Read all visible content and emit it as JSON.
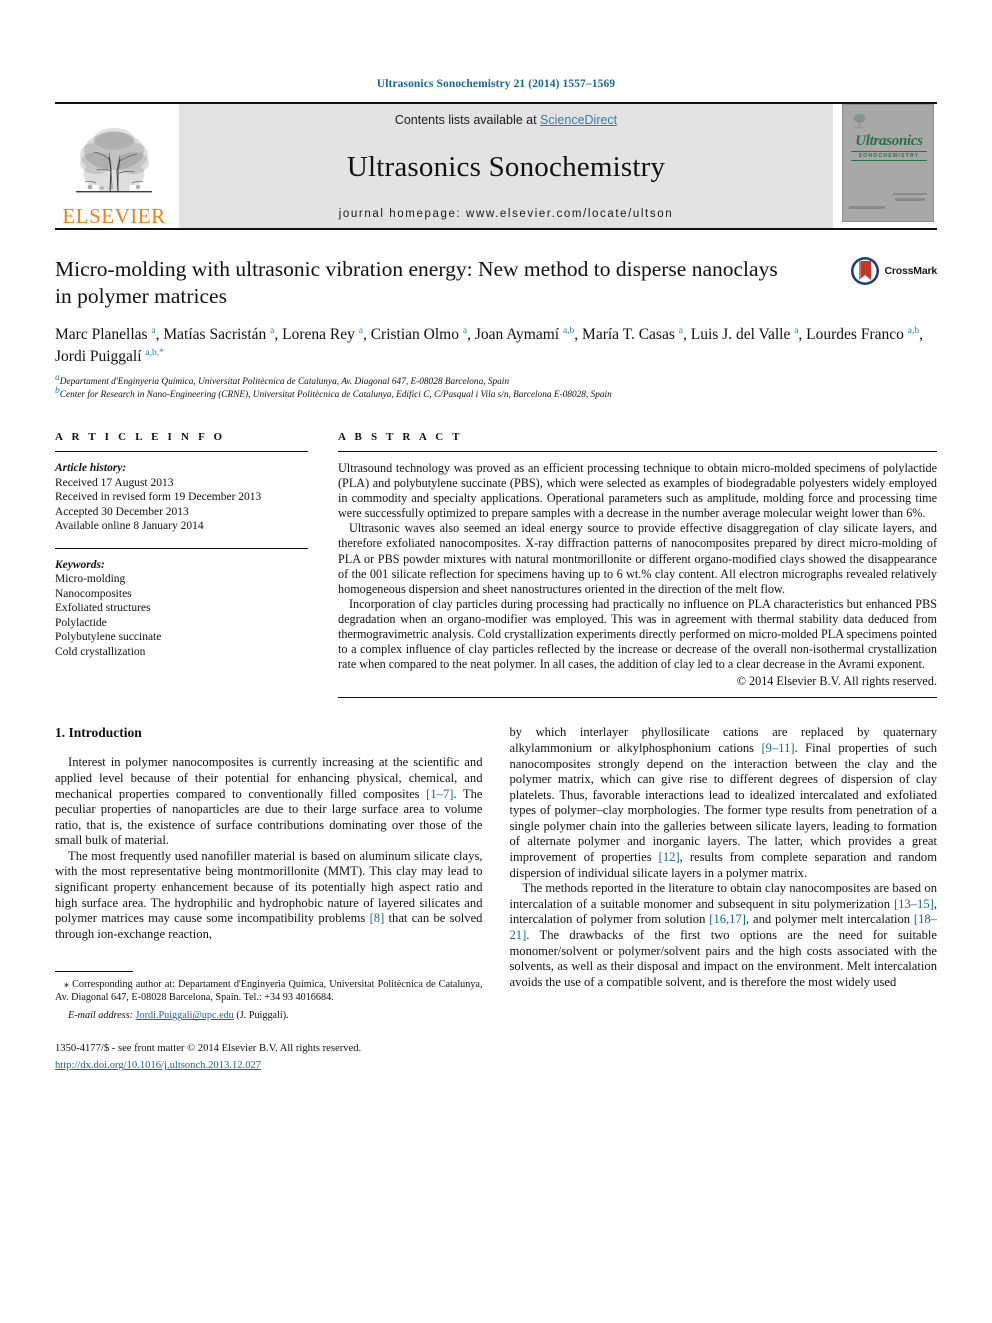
{
  "running_head": "Ultrasonics Sonochemistry 21 (2014) 1557–1569",
  "masthead": {
    "publisher": "ELSEVIER",
    "contents_prefix": "Contents lists available at ",
    "contents_link": "ScienceDirect",
    "journal_name": "Ultrasonics Sonochemistry",
    "homepage": "journal homepage: www.elsevier.com/locate/ultson",
    "cover": {
      "title": "Ultrasonics",
      "subtitle": "SONOCHEMISTRY"
    }
  },
  "article": {
    "title": "Micro-molding with ultrasonic vibration energy: New method to disperse nanoclays in polymer matrices",
    "crossmark_label": "CrossMark",
    "authors_html": "Marc Planellas <sup>a</sup>, Matías Sacristán <sup>a</sup>, Lorena Rey <sup>a</sup>, Cristian Olmo <sup>a</sup>, Joan Aymamí <sup>a,b</sup>, María T. Casas <sup>a</sup>, Luis J. del Valle <sup>a</sup>, Lourdes Franco <sup>a,b</sup>, Jordi Puiggalí <sup>a,b,</sup><sup>*</sup>",
    "affiliations": [
      "Departament d'Enginyeria Química, Universitat Politècnica de Catalunya, Av. Diagonal 647, E-08028 Barcelona, Spain",
      "Center for Research in Nano-Engineering (CRNE), Universitat Politècnica de Catalunya, Edifici C, C/Pasqual i Vila s/n, Barcelona E-08028, Spain"
    ]
  },
  "article_info": {
    "heading": "A R T I C L E    I N F O",
    "history_label": "Article history:",
    "history": [
      "Received 17 August 2013",
      "Received in revised form 19 December 2013",
      "Accepted 30 December 2013",
      "Available online 8 January 2014"
    ],
    "keywords_label": "Keywords:",
    "keywords": [
      "Micro-molding",
      "Nanocomposites",
      "Exfoliated structures",
      "Polylactide",
      "Polybutylene succinate",
      "Cold crystallization"
    ]
  },
  "abstract": {
    "heading": "A B S T R A C T",
    "paragraphs": [
      "Ultrasound technology was proved as an efficient processing technique to obtain micro-molded specimens of polylactide (PLA) and polybutylene succinate (PBS), which were selected as examples of biodegradable polyesters widely employed in commodity and specialty applications. Operational parameters such as amplitude, molding force and processing time were successfully optimized to prepare samples with a decrease in the number average molecular weight lower than 6%.",
      "Ultrasonic waves also seemed an ideal energy source to provide effective disaggregation of clay silicate layers, and therefore exfoliated nanocomposites. X-ray diffraction patterns of nanocomposites prepared by direct micro-molding of PLA or PBS powder mixtures with natural montmorillonite or different organo-modified clays showed the disappearance of the 001 silicate reflection for specimens having up to 6 wt.% clay content. All electron micrographs revealed relatively homogeneous dispersion and sheet nanostructures oriented in the direction of the melt flow.",
      "Incorporation of clay particles during processing had practically no influence on PLA characteristics but enhanced PBS degradation when an organo-modifier was employed. This was in agreement with thermal stability data deduced from thermogravimetric analysis. Cold crystallization experiments directly performed on micro-molded PLA specimens pointed to a complex influence of clay particles reflected by the increase or decrease of the overall non-isothermal crystallization rate when compared to the neat polymer. In all cases, the addition of clay led to a clear decrease in the Avrami exponent."
    ],
    "copyright": "© 2014 Elsevier B.V. All rights reserved."
  },
  "introduction": {
    "heading": "1. Introduction",
    "left_paragraphs": [
      "Interest in polymer nanocomposites is currently increasing at the scientific and applied level because of their potential for enhancing physical, chemical, and mechanical properties compared to conventionally filled composites [1–7]. The peculiar properties of nanoparticles are due to their large surface area to volume ratio, that is, the existence of surface contributions dominating over those of the small bulk of material.",
      "The most frequently used nanofiller material is based on aluminum silicate clays, with the most representative being montmorillonite (MMT). This clay may lead to significant property enhancement because of its potentially high aspect ratio and high surface area. The hydrophilic and hydrophobic nature of layered silicates and polymer matrices may cause some incompatibility problems [8] that can be solved through ion-exchange reaction,"
    ],
    "right_paragraphs": [
      "by which interlayer phyllosilicate cations are replaced by quaternary alkylammonium or alkylphosphonium cations [9–11]. Final properties of such nanocomposites strongly depend on the interaction between the clay and the polymer matrix, which can give rise to different degrees of dispersion of clay platelets. Thus, favorable interactions lead to idealized intercalated and exfoliated types of polymer–clay morphologies. The former type results from penetration of a single polymer chain into the galleries between silicate layers, leading to formation of alternate polymer and inorganic layers. The latter, which provides a great improvement of properties [12], results from complete separation and random dispersion of individual silicate layers in a polymer matrix.",
      "The methods reported in the literature to obtain clay nanocomposites are based on intercalation of a suitable monomer and subsequent in situ polymerization [13–15], intercalation of polymer from solution [16,17], and polymer melt intercalation [18–21]. The drawbacks of the first two options are the need for suitable monomer/solvent or polymer/solvent pairs and the high costs associated with the solvents, as well as their disposal and impact on the environment. Melt intercalation avoids the use of a compatible solvent, and is therefore the most widely used"
    ]
  },
  "footnotes": {
    "corresponding": "Corresponding author at: Departament d'Enginyeria Química, Universitat Politècnica de Catalunya, Av. Diagonal 647, E-08028 Barcelona, Spain. Tel.: +34 93 4016684.",
    "email_label": "E-mail address:",
    "email": "Jordi.Puiggali@upc.edu",
    "email_suffix": "(J. Puiggalí).",
    "issn_line": "1350-4177/$ - see front matter © 2014 Elsevier B.V. All rights reserved.",
    "doi": "http://dx.doi.org/10.1016/j.ultsonch.2013.12.027"
  },
  "colors": {
    "link": "#1a6496",
    "elsevier_orange": "#ef7d1a",
    "band_gray": "#e3e3e3",
    "cover_green": "#2f6b4f"
  }
}
